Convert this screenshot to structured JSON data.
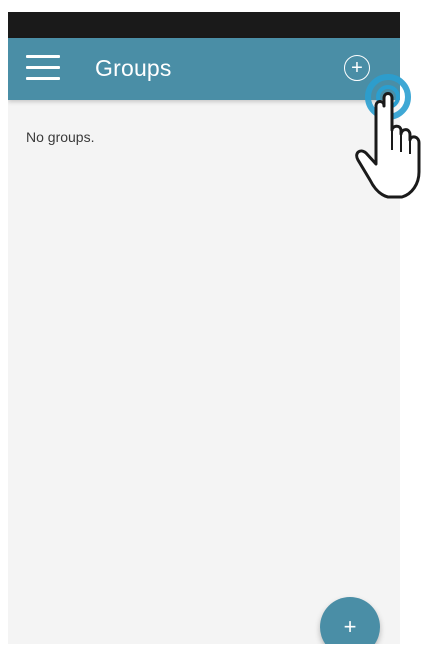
{
  "app_bar": {
    "title": "Groups",
    "menu_icon": "hamburger-menu-icon",
    "add_icon": "plus-circle-icon",
    "add_symbol": "+",
    "background_color": "#4a8ea6"
  },
  "content": {
    "empty_message": "No groups."
  },
  "fab": {
    "symbol": "+",
    "icon": "plus-icon",
    "color": "#4a8ea6"
  },
  "overlay": {
    "icon": "tap-gesture-hand-icon",
    "ring_color": "#2a9fd0"
  }
}
